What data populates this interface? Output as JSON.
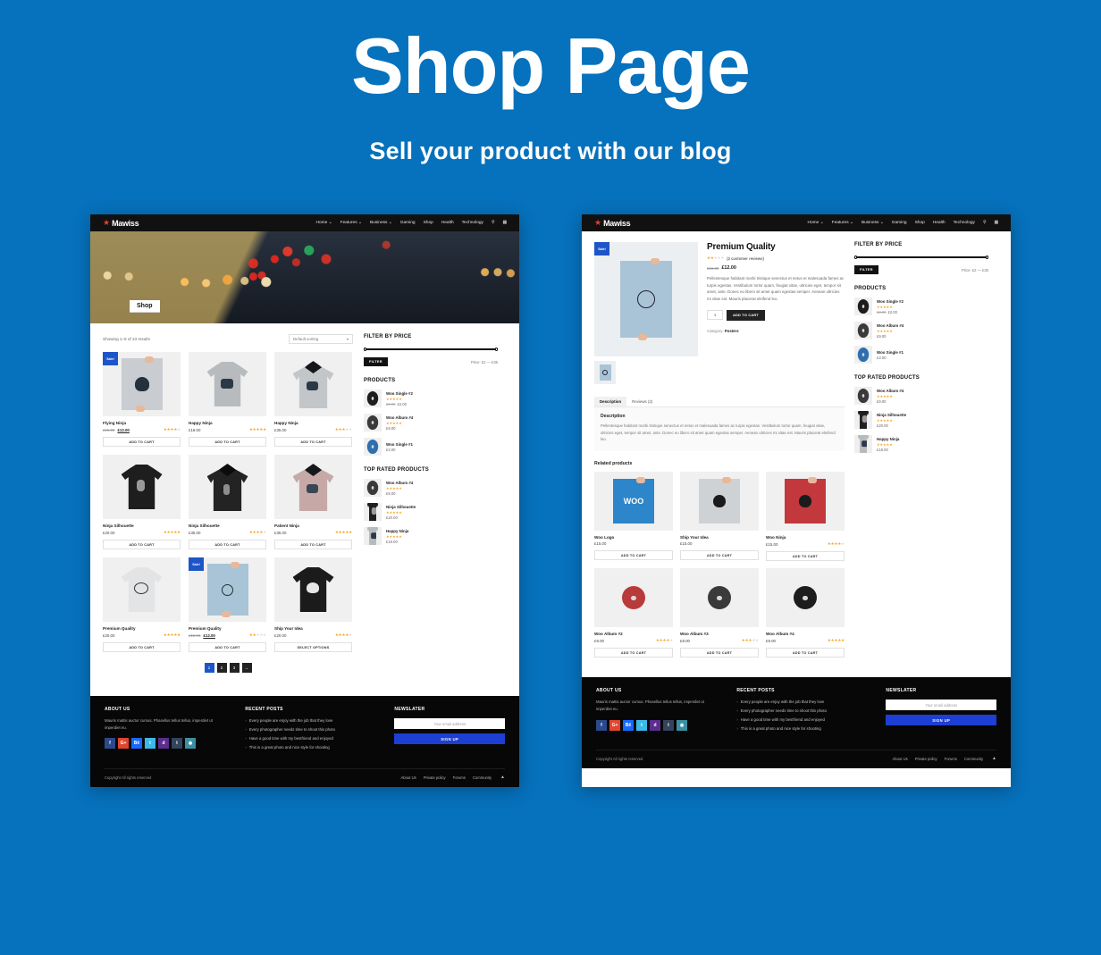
{
  "promo": {
    "title": "Shop Page",
    "subtitle": "Sell your product with our blog"
  },
  "colors": {
    "background": "#0671bc",
    "accent_blue": "#1d55c9",
    "star": "#f5a623",
    "dark": "#111111"
  },
  "nav": {
    "logo": "Mawiss",
    "items": [
      "Home  ⌄",
      "Features  ⌄",
      "Business  ⌄",
      "Gaming",
      "Shop",
      "Health",
      "Technology"
    ],
    "search_icon": "search-icon",
    "menu_icon": "grid-menu-icon"
  },
  "shop_page": {
    "hero_label": "Shop",
    "results_text": "Showing 1–9 of 23 results",
    "sorting": {
      "value": "Default sorting",
      "caret": "▾"
    },
    "add_to_cart": "ADD TO CART",
    "select_options": "SELECT OPTIONS",
    "sale_badge": "Sale!",
    "products": [
      {
        "name": "Flying Ninja",
        "old_price": "£15.00",
        "price": "£12.00",
        "on_sale": true,
        "stars": 4,
        "button": "ADD TO CART",
        "art": "poster-ninja"
      },
      {
        "name": "Happy Ninja",
        "old_price": "",
        "price": "£18.00",
        "on_sale": false,
        "stars": 5,
        "button": "ADD TO CART",
        "art": "shirt-grey"
      },
      {
        "name": "Happy Ninja",
        "old_price": "",
        "price": "£35.00",
        "on_sale": false,
        "stars": 3,
        "button": "ADD TO CART",
        "art": "hoodie-grey"
      },
      {
        "name": "Ninja Silhouette",
        "old_price": "",
        "price": "£20.00",
        "on_sale": false,
        "stars": 5,
        "button": "ADD TO CART",
        "art": "shirt-black"
      },
      {
        "name": "Ninja Silhouette",
        "old_price": "",
        "price": "£35.00",
        "on_sale": false,
        "stars": 4,
        "button": "ADD TO CART",
        "art": "hoodie-black"
      },
      {
        "name": "Patient Ninja",
        "old_price": "",
        "price": "£35.00",
        "on_sale": false,
        "stars": 5,
        "button": "ADD TO CART",
        "art": "hoodie-pink"
      },
      {
        "name": "Premium Quality",
        "old_price": "",
        "price": "£20.00",
        "on_sale": false,
        "stars": 5,
        "button": "ADD TO CART",
        "art": "shirt-white"
      },
      {
        "name": "Premium Quality",
        "old_price": "£15.00",
        "price": "£12.00",
        "on_sale": true,
        "stars": 2,
        "button": "ADD TO CART",
        "art": "poster-blue"
      },
      {
        "name": "Ship Your Idea",
        "old_price": "",
        "price": "£20.00",
        "on_sale": false,
        "stars": 4,
        "button": "SELECT OPTIONS",
        "art": "shirt-skull"
      }
    ],
    "pagination": {
      "pages": [
        "1",
        "2",
        "3"
      ],
      "next": "→",
      "active": "1"
    }
  },
  "sidebar": {
    "filter_title": "FILTER BY PRICE",
    "filter_button": "FILTER",
    "price_range": "Price: £2 — £35",
    "products_title": "PRODUCTS",
    "products": [
      {
        "name": "Woo Single #2",
        "stars": 5,
        "old_price": "£3.00",
        "price": "£2.00",
        "art": "disc-dark"
      },
      {
        "name": "Woo Album #4",
        "stars": 5,
        "old_price": "",
        "price": "£9.00",
        "art": "disc-grey"
      },
      {
        "name": "Woo Single #1",
        "stars": 0,
        "old_price": "",
        "price": "£3.00",
        "art": "disc-blue"
      }
    ],
    "top_rated_title": "TOP RATED PRODUCTS",
    "top_rated": [
      {
        "name": "Woo Album #4",
        "stars": 5,
        "price": "£9.00",
        "art": "disc-grey"
      },
      {
        "name": "Ninja Silhouette",
        "stars": 5,
        "price": "£20.00",
        "art": "shirt-black"
      },
      {
        "name": "Happy Ninja",
        "stars": 5,
        "price": "£18.00",
        "art": "shirt-grey"
      }
    ]
  },
  "single_page": {
    "sale_badge": "Sale!",
    "title": "Premium Quality",
    "stars": 2,
    "reviews_text": "(2 customer reviews)",
    "old_price": "£15.00",
    "price": "£12.00",
    "description": "Pellentesque habitant morbi tristique senectus et netus et malesuada fames ac turpis egestas. Vestibulum tortor quam, feugiat vitae, ultricies eget, tempor sit amet, ante. Donec eu libero sit amet quam egestas semper. Aenean ultricies mi vitae est. Mauris placerat eleifend leo.",
    "quantity": "1",
    "add_to_cart": "ADD TO CART",
    "category_label": "Category:",
    "category_value": "Posters",
    "tabs": [
      {
        "label": "Description",
        "active": true
      },
      {
        "label": "Reviews (2)",
        "active": false
      }
    ],
    "panel_heading": "Description",
    "panel_text": "Pellentesque habitant morbi tristique senectus et netus et malesuada fames ac turpis egestas. Vestibulum tortor quam, feugiat vitae, ultricies eget, tempor sit amet, ante. Donec eu libero sit amet quam egestas semper. Aenean ultricies mi vitae est. Mauris placerat eleifend leo.",
    "related_title": "Related products",
    "related": [
      {
        "name": "Woo Logo",
        "price": "£15.00",
        "stars": 0,
        "button": "ADD TO CART",
        "art": "poster-blue2"
      },
      {
        "name": "Ship Your Idea",
        "price": "£15.00",
        "stars": 0,
        "button": "ADD TO CART",
        "art": "poster-grey"
      },
      {
        "name": "Woo Ninja",
        "price": "£15.00",
        "stars": 4,
        "button": "ADD TO CART",
        "art": "poster-red"
      },
      {
        "name": "Woo Album #2",
        "price": "£9.00",
        "stars": 4,
        "button": "ADD TO CART",
        "art": "disc-red"
      },
      {
        "name": "Woo Album #3",
        "price": "£9.00",
        "stars": 3,
        "button": "ADD TO CART",
        "art": "disc-grey"
      },
      {
        "name": "Woo Album #4",
        "price": "£9.00",
        "stars": 5,
        "button": "ADD TO CART",
        "art": "disc-dark"
      }
    ]
  },
  "footer": {
    "about_title": "ABOUT US",
    "about_text": "Mauris mattis auctor cursus. Phasellus tellus tellus, imperdiet ut imperdiet eu.",
    "socials": [
      {
        "name": "facebook-icon",
        "glyph": "f",
        "color": "#2b4a8b"
      },
      {
        "name": "googleplus-icon",
        "glyph": "G+",
        "color": "#e0452f"
      },
      {
        "name": "behance-icon",
        "glyph": "Bē",
        "color": "#1769ff"
      },
      {
        "name": "twitter-icon",
        "glyph": "t",
        "color": "#3cb8e8"
      },
      {
        "name": "dribbble-icon",
        "glyph": "d",
        "color": "#5b2d8e"
      },
      {
        "name": "tumblr-icon",
        "glyph": "t",
        "color": "#33445c"
      },
      {
        "name": "instagram-icon",
        "glyph": "◉",
        "color": "#3b8fa3"
      }
    ],
    "posts_title": "RECENT POSTS",
    "posts": [
      "Every people are enjoy with the job that they love",
      "Every photographer needs time to shoot this photo",
      "Have a good time with my bestfriend and enjoyed",
      "This is a great photo and nice style for shooting"
    ],
    "newsletter_title": "NEWSLATER",
    "email_placeholder": "Your email address",
    "signup_label": "SIGN UP",
    "copyright": "Copyright All rights reserved",
    "links": [
      "About Us",
      "Private policy",
      "Forums",
      "Community"
    ],
    "to_top": "▲"
  }
}
